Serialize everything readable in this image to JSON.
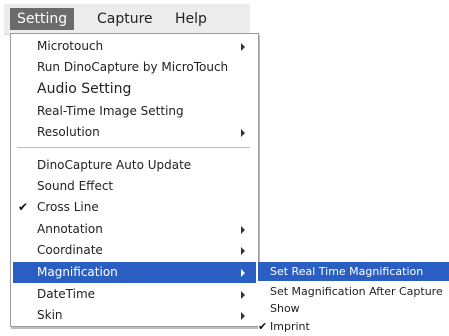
{
  "menubar": {
    "items": [
      {
        "label": "Setting"
      },
      {
        "label": "Capture"
      },
      {
        "label": "Help"
      }
    ]
  },
  "setting_menu": {
    "items": [
      {
        "label": "Microtouch"
      },
      {
        "label": "Run DinoCapture by MicroTouch"
      },
      {
        "label": "Audio Setting"
      },
      {
        "label": "Real-Time Image Setting"
      },
      {
        "label": "Resolution"
      },
      {
        "label": "DinoCapture Auto Update"
      },
      {
        "label": "Sound Effect"
      },
      {
        "label": "Cross Line"
      },
      {
        "label": "Annotation"
      },
      {
        "label": "Coordinate"
      },
      {
        "label": "Magnification"
      },
      {
        "label": "DateTime"
      },
      {
        "label": "Skin"
      }
    ],
    "check_glyph": "✔"
  },
  "magnification_submenu": {
    "items": [
      {
        "label": "Set Real Time Magnification"
      },
      {
        "label": "Set Magnification After Capture"
      },
      {
        "label": "Show"
      },
      {
        "label": "Imprint"
      }
    ]
  },
  "colors": {
    "highlight": "#2a5ec3",
    "active_menubar": "#6b6b6b"
  }
}
